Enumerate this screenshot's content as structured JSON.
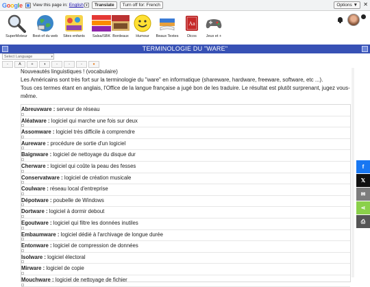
{
  "gtranslate": {
    "view_label": "View this page in:",
    "language": "English",
    "translate_btn": "Translate",
    "turnoff_btn": "Turn off for: French",
    "options_btn": "Options ▼",
    "close": "✕"
  },
  "nav": {
    "items": [
      {
        "label": "SuperMoteur",
        "icon": "magnifier-icon"
      },
      {
        "label": "Best-of du web",
        "icon": "globe-icon"
      },
      {
        "label": "Sites enfants",
        "icon": "kids-icon"
      },
      {
        "label": "Salsa/SBK",
        "icon": "salsa-icon"
      },
      {
        "label": "Bordeaux",
        "icon": "bordeaux-icon"
      },
      {
        "label": "Humour",
        "icon": "smiley-icon"
      },
      {
        "label": "Beaux Textes",
        "icon": "book-icon"
      },
      {
        "label": "Dicos",
        "icon": "dictionary-icon"
      },
      {
        "label": "Jeux et +",
        "icon": "gamepad-icon"
      }
    ]
  },
  "title": "TERMINOLOGIE DU \"WARE\"",
  "select_language": "Select Language",
  "tools": [
    "-",
    "A",
    "+",
    "◑",
    "-",
    "-",
    "-",
    "●"
  ],
  "intro": {
    "line1": "Nouveautés linguistiques ! (vocabulaire)",
    "line2": "Les Américains sont très fort sur la terminologie du \"ware\" en informatique (shareware, hardware, freeware, software, etc ...).",
    "line3": "Tous ces termes étant en anglais, l'Office de la langue française a jugé bon de les traduire. Le résultat est plutôt surprenant, jugez vous-même."
  },
  "terms": [
    {
      "term": "Abreuvware :",
      "def": " serveur de réseau"
    },
    {
      "term": "Aléatware :",
      "def": " logiciel qui marche une fois sur deux"
    },
    {
      "term": "Assomware :",
      "def": " logiciel très difficile à comprendre"
    },
    {
      "term": "Aureware :",
      "def": " procédure de sortie d'un logiciel"
    },
    {
      "term": "Baignware :",
      "def": " logiciel de nettoyage du disque dur"
    },
    {
      "term": "Cherware :",
      "def": " logiciel qui coûte la peau des fesses"
    },
    {
      "term": "Conservatware :",
      "def": " logiciel de création musicale"
    },
    {
      "term": "Coulware :",
      "def": " réseau local d'entreprise"
    },
    {
      "term": "Dépotware :",
      "def": " poubelle de Windows"
    },
    {
      "term": "Dortware :",
      "def": " logiciel à dormir debout"
    },
    {
      "term": "Egoutware :",
      "def": " logiciel qui filtre les données inutiles"
    },
    {
      "term": "Embaumware :",
      "def": " logiciel dédié à l'archivage de longue durée"
    },
    {
      "term": "Entonware :",
      "def": " logiciel de compression de données"
    },
    {
      "term": "Isolware :",
      "def": " logiciel électoral"
    },
    {
      "term": "Mirware :",
      "def": " logiciel de copie"
    },
    {
      "term": "Mouchware :",
      "def": " logiciel de nettoyage de fichier"
    }
  ],
  "share": {
    "facebook": "f",
    "x": "𝕏",
    "email": "✉",
    "share": "⋖",
    "print": "⎙"
  }
}
